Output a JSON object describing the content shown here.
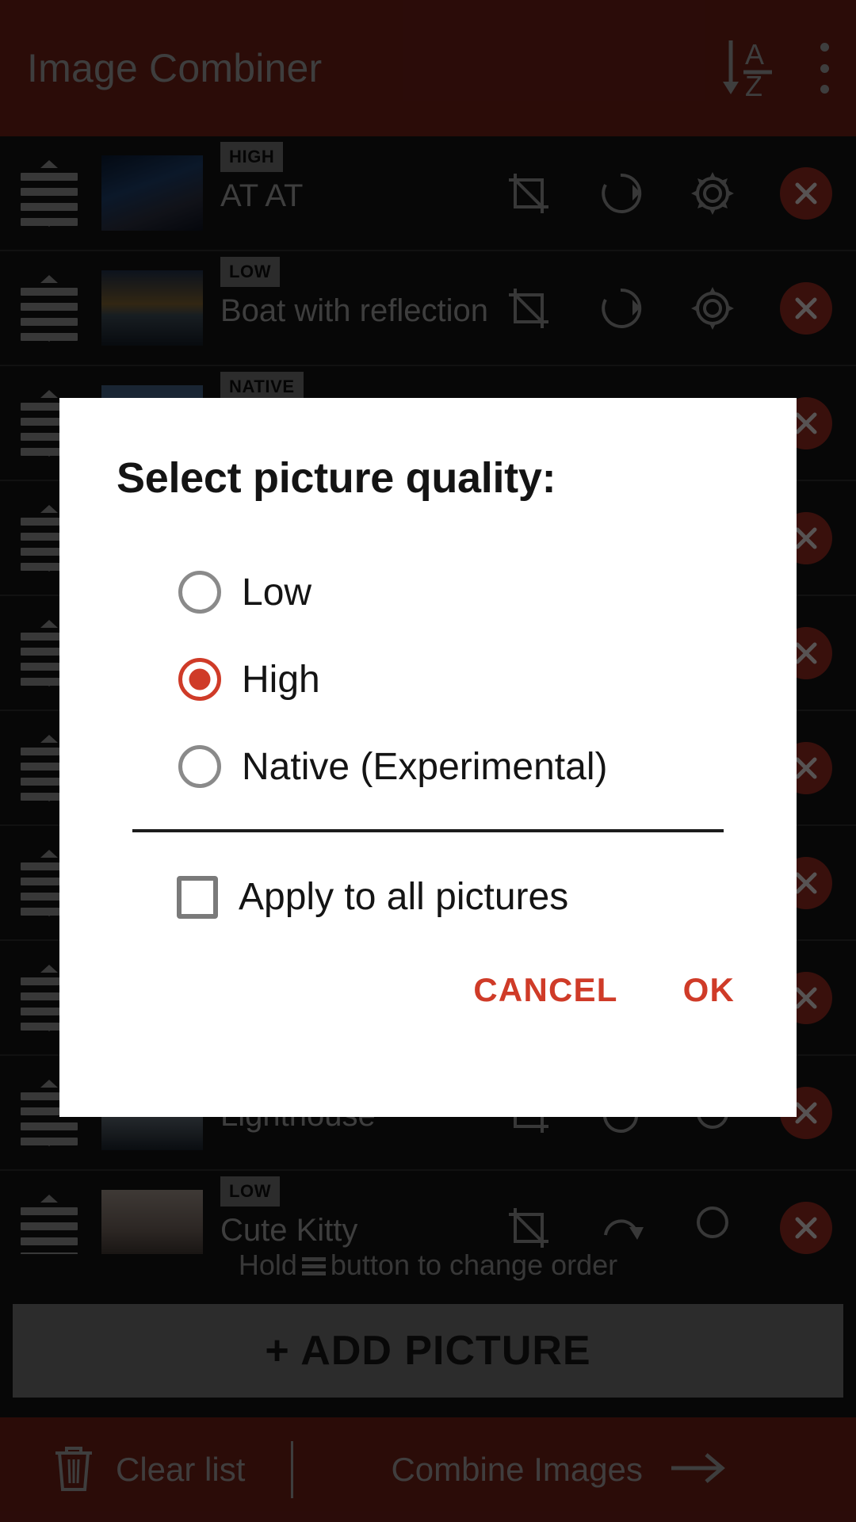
{
  "header": {
    "title": "Image Combiner",
    "sort_icon": "sort-alpha-asc-icon",
    "sort_top_letter": "A",
    "sort_bottom_letter": "Z",
    "overflow_icon": "more-vertical-icon"
  },
  "list": {
    "rows": [
      {
        "badge": "HIGH",
        "title": "AT AT"
      },
      {
        "badge": "LOW",
        "title": "Boat with reflection"
      },
      {
        "badge": "NATIVE",
        "title": ""
      },
      {
        "badge": "",
        "title": ""
      },
      {
        "badge": "",
        "title": ""
      },
      {
        "badge": "",
        "title": ""
      },
      {
        "badge": "",
        "title": ""
      },
      {
        "badge": "",
        "title": ""
      },
      {
        "badge": "",
        "title": "Lighthouse"
      },
      {
        "badge": "LOW",
        "title": "Cute Kitty"
      }
    ],
    "row_icons": {
      "crop": "crop-icon",
      "rotate": "rotate-icon",
      "settings": "gear-icon",
      "remove": "close-circle-icon"
    },
    "drag_handle_icon": "drag-handle-icon"
  },
  "hint": {
    "prefix": "Hold",
    "suffix": "button to change order",
    "icon": "drag-handle-icon"
  },
  "add_button": {
    "label": "+ ADD PICTURE"
  },
  "bottom_bar": {
    "clear_icon": "trash-icon",
    "clear_label": "Clear list",
    "combine_label": "Combine Images",
    "combine_icon": "arrow-right-icon"
  },
  "dialog": {
    "title": "Select picture quality:",
    "options": [
      {
        "label": "Low",
        "selected": false
      },
      {
        "label": "High",
        "selected": true
      },
      {
        "label": "Native (Experimental)",
        "selected": false
      }
    ],
    "checkbox": {
      "label": "Apply to all pictures",
      "checked": false
    },
    "cancel_label": "CANCEL",
    "ok_label": "OK"
  },
  "colors": {
    "brand": "#6b1e16",
    "accent": "#cf3b28",
    "surface": "#121212",
    "dialog_bg": "#ffffff",
    "muted_text": "#9b9b9b"
  }
}
